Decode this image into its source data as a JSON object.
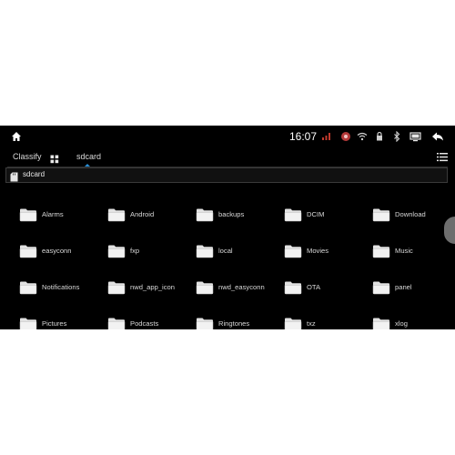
{
  "status_bar": {
    "time": "16:07",
    "icons": [
      "home-icon",
      "signal-icon",
      "media-icon",
      "wifi-icon",
      "lock-icon",
      "bluetooth-icon",
      "screen-icon",
      "back-arrow-icon"
    ]
  },
  "tabs": {
    "classify_label": "Classify",
    "active_label": "sdcard"
  },
  "path_bar": {
    "label": "sdcard"
  },
  "files": [
    {
      "name": "Alarms"
    },
    {
      "name": "Android"
    },
    {
      "name": "backups"
    },
    {
      "name": "DCIM"
    },
    {
      "name": "Download"
    },
    {
      "name": "easyconn"
    },
    {
      "name": "fxp"
    },
    {
      "name": "local"
    },
    {
      "name": "Movies"
    },
    {
      "name": "Music"
    },
    {
      "name": "Notifications"
    },
    {
      "name": "nwd_app_icon"
    },
    {
      "name": "nwd_easyconn"
    },
    {
      "name": "OTA"
    },
    {
      "name": "panel"
    },
    {
      "name": "Pictures"
    },
    {
      "name": "Podcasts"
    },
    {
      "name": "Ringtones"
    },
    {
      "name": "txz"
    },
    {
      "name": "xlog"
    }
  ],
  "colors": {
    "accent": "#2a8fd6",
    "background": "#000000",
    "folder": "#e2e2e2"
  }
}
